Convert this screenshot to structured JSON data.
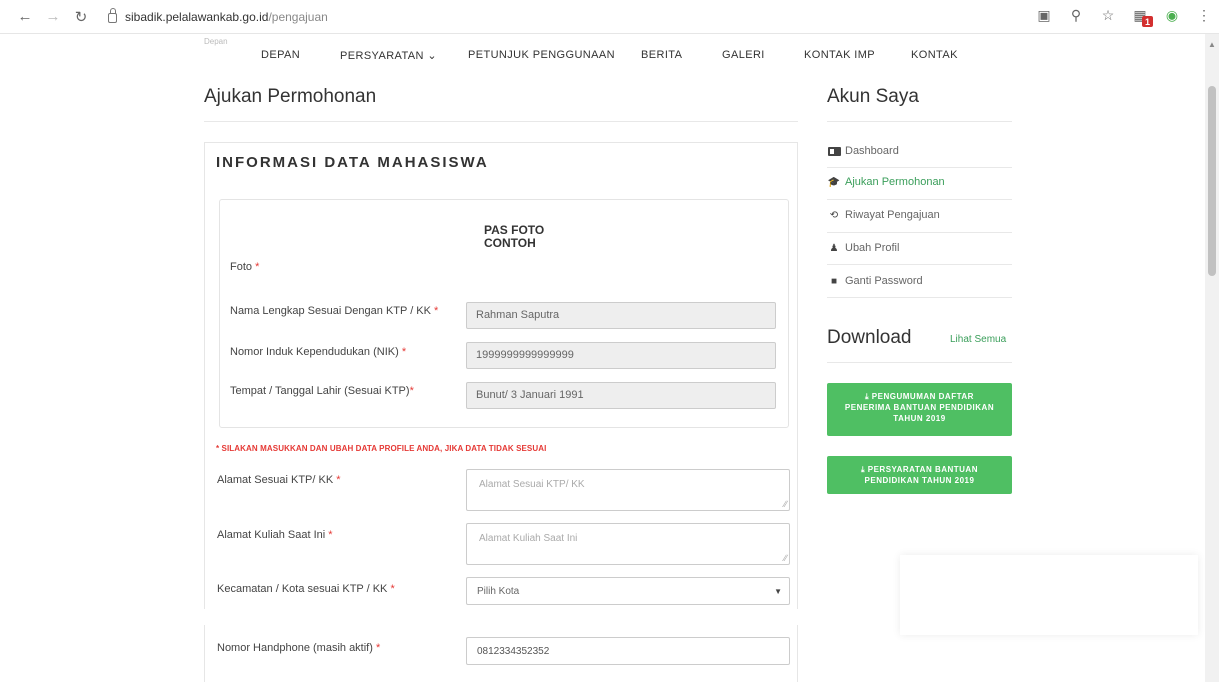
{
  "browser": {
    "url_host": "sibadik.pelalawankab.go.id",
    "url_path": "/pengajuan",
    "extension_badge": "1"
  },
  "topnav": {
    "breadcrumb": "Depan",
    "items": [
      "DEPAN",
      "PERSYARATAN ⌄",
      "PETUNJUK PENGGUNAAN",
      "BERITA",
      "GALERI",
      "KONTAK IMP",
      "KONTAK"
    ]
  },
  "main": {
    "page_title": "Ajukan Permohonan",
    "card_title": "INFORMASI DATA MAHASISWA",
    "photo_label": "Foto",
    "photo_text_line1": "PAS FOTO",
    "photo_text_line2": "CONTOH",
    "name_label": "Nama Lengkap Sesuai Dengan KTP / KK",
    "name_value": "Rahman Saputra",
    "nik_label": "Nomor Induk Kependudukan (NIK)",
    "nik_value": "1999999999999999",
    "birth_label": "Tempat / Tanggal Lahir (Sesuai KTP)",
    "birth_value": "Bunut/ 3 Januari 1991",
    "notice": "* SILAKAN MASUKKAN DAN UBAH DATA PROFILE ANDA, JIKA DATA TIDAK SESUAI",
    "address_label": "Alamat Sesuai KTP/ KK",
    "address_placeholder": "Alamat Sesuai KTP/ KK",
    "campus_address_label": "Alamat Kuliah Saat Ini",
    "campus_address_placeholder": "Alamat Kuliah Saat Ini",
    "district_label": "Kecamatan / Kota sesuai KTP / KK",
    "district_selected": "Pilih Kota",
    "phone_label": "Nomor Handphone (masih aktif)",
    "phone_value": "0812334352352",
    "required_mark": "*"
  },
  "sidebar": {
    "title": "Akun Saya",
    "items": [
      {
        "label": "Dashboard",
        "icon": "dashboard-icon"
      },
      {
        "label": "Ajukan Permohonan",
        "icon": "graduation-cap-icon"
      },
      {
        "label": "Riwayat Pengajuan",
        "icon": "history-icon"
      },
      {
        "label": "Ubah Profil",
        "icon": "user-icon"
      },
      {
        "label": "Ganti Password",
        "icon": "lock-icon"
      }
    ],
    "download_title": "Download",
    "see_all": "Lihat Semua",
    "download_buttons": [
      {
        "line1": "⤓ PENGUMUMAN DAFTAR",
        "line2": "PENERIMA BANTUAN PENDIDIKAN",
        "line3": "TAHUN 2019"
      },
      {
        "line1": "⤓ PERSYARATAN BANTUAN",
        "line2": "PENDIDIKAN TAHUN 2019"
      }
    ]
  },
  "colors": {
    "accent_green": "#4fbf63",
    "link_green": "#3a9e5a",
    "required_red": "#e53935"
  }
}
